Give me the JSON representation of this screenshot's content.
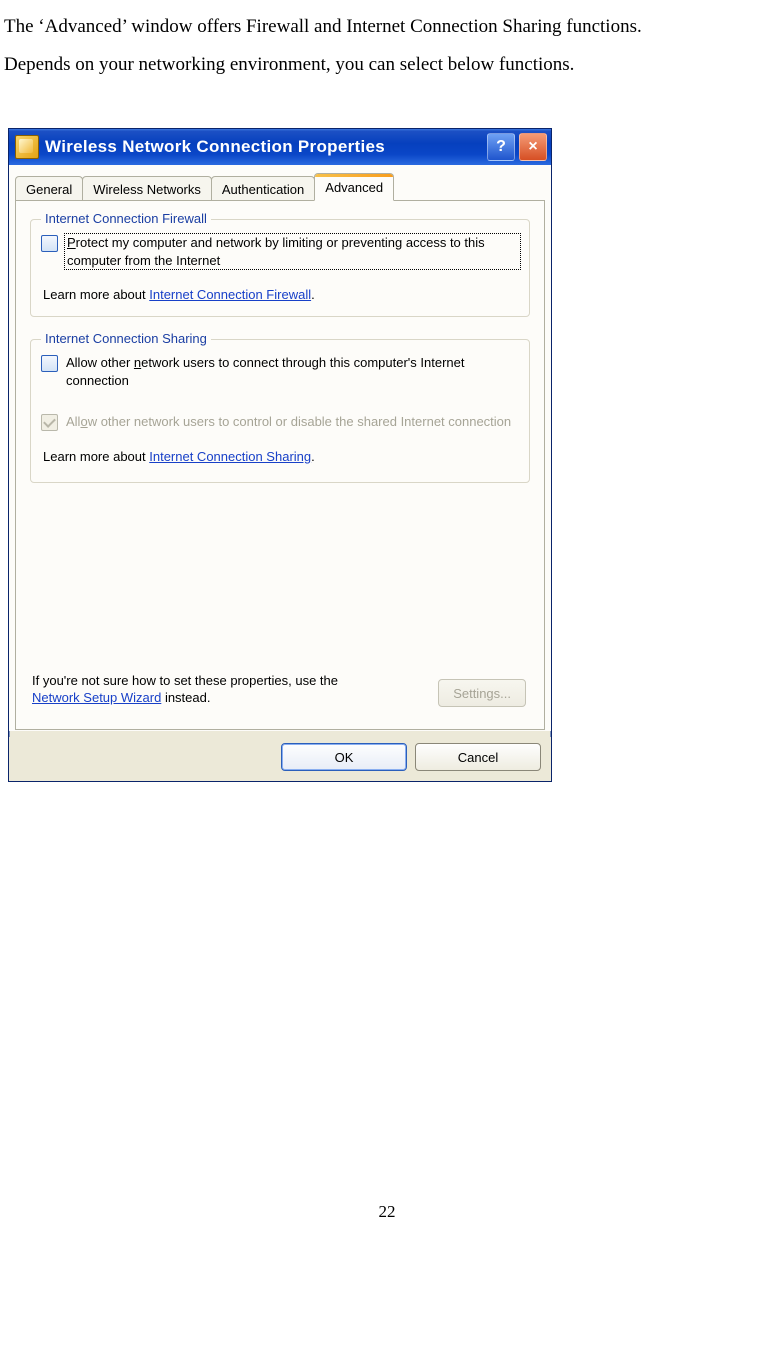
{
  "doc": {
    "line1": "The ‘Advanced’ window offers Firewall and Internet Connection Sharing functions.",
    "line2": "Depends on your networking environment, you can select below functions.",
    "page_number": "22"
  },
  "window": {
    "title": "Wireless Network Connection Properties",
    "titlebar_buttons": {
      "help": "?",
      "close": "×"
    }
  },
  "tabs": {
    "general": "General",
    "wireless": "Wireless Networks",
    "auth": "Authentication",
    "advanced": "Advanced"
  },
  "firewall_group": {
    "legend": "Internet Connection Firewall",
    "checkbox_pre": "",
    "checkbox_underline": "P",
    "checkbox_rest": "rotect my computer and network by limiting or preventing access to this computer from the Internet",
    "learn_prefix": "Learn more about ",
    "learn_link": "Internet Connection Firewall",
    "learn_suffix": "."
  },
  "sharing_group": {
    "legend": "Internet Connection Sharing",
    "cb1_pre": "Allow other ",
    "cb1_underline": "n",
    "cb1_rest": "etwork users to connect through this computer's Internet connection",
    "cb2_pre": "All",
    "cb2_underline": "o",
    "cb2_rest": "w other network users to control or disable the shared Internet connection",
    "learn_prefix": "Learn more about ",
    "learn_link": "Internet Connection Sharing",
    "learn_suffix": "."
  },
  "bottom": {
    "note_prefix": "If you're not sure how to set these properties, use the ",
    "note_link": "Network Setup Wizard",
    "note_suffix": " instead.",
    "settings_label": "Settings..."
  },
  "dialog_buttons": {
    "ok": "OK",
    "cancel": "Cancel"
  }
}
